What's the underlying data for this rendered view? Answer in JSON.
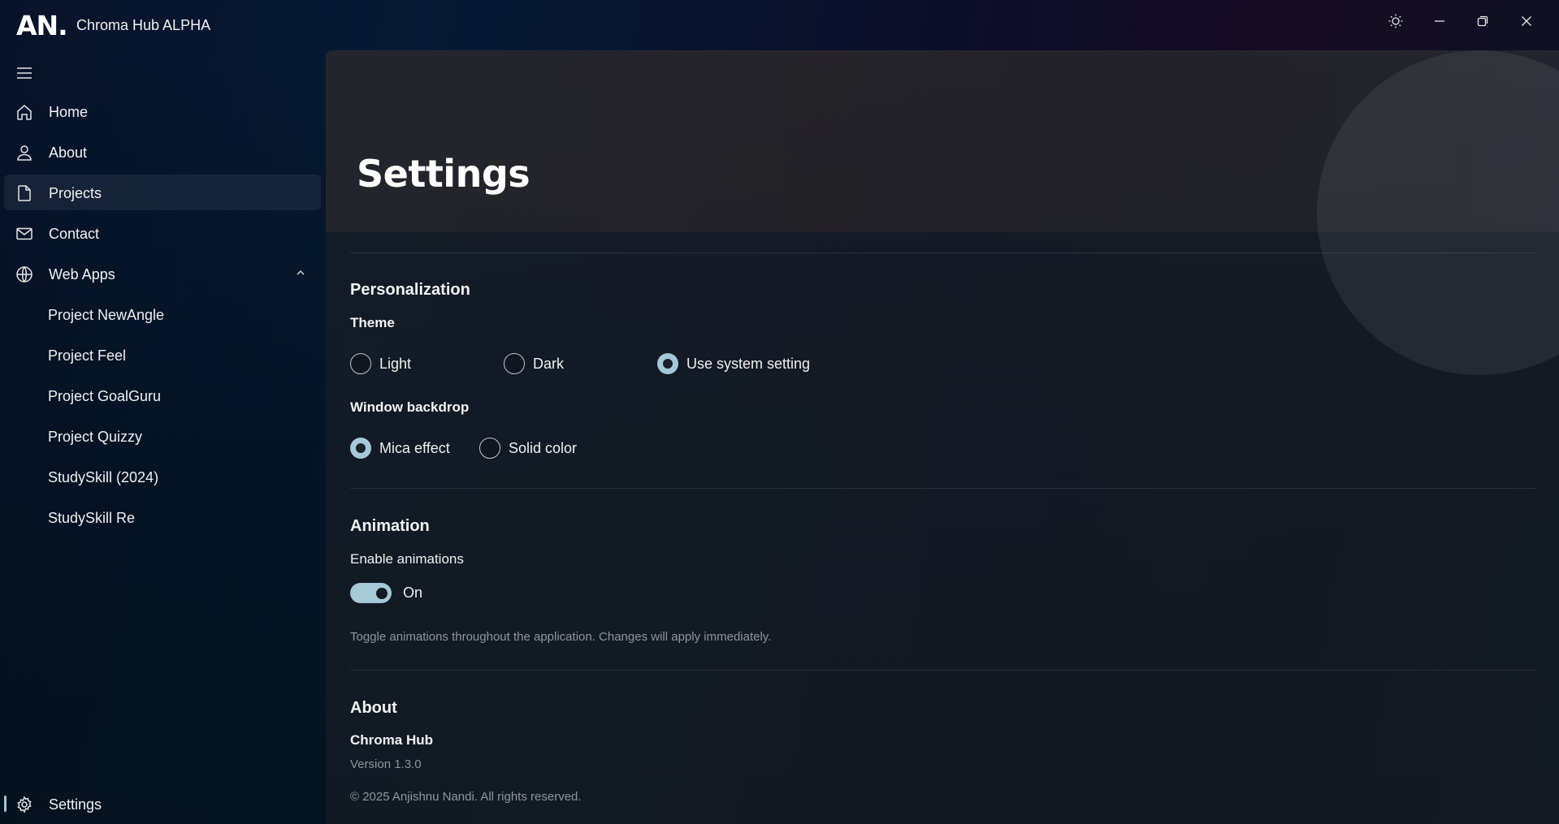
{
  "titlebar": {
    "logo": "AN.",
    "title": "Chroma Hub ALPHA",
    "buttons": [
      "theme-toggle",
      "minimize",
      "restore",
      "close"
    ]
  },
  "sidebar": {
    "items": [
      {
        "label": "Home",
        "icon": "home-icon"
      },
      {
        "label": "About",
        "icon": "person-icon"
      },
      {
        "label": "Projects",
        "icon": "document-icon",
        "active": true
      },
      {
        "label": "Contact",
        "icon": "mail-icon"
      },
      {
        "label": "Web Apps",
        "icon": "globe-icon",
        "expanded": true
      }
    ],
    "sub_items": [
      {
        "label": "Project NewAngle"
      },
      {
        "label": "Project Feel"
      },
      {
        "label": "Project GoalGuru"
      },
      {
        "label": "Project Quizzy"
      },
      {
        "label": "StudySkill (2024)"
      },
      {
        "label": "StudySkill Re"
      }
    ],
    "settings": {
      "label": "Settings",
      "icon": "gear-icon",
      "selected": true
    }
  },
  "main": {
    "title": "Settings",
    "personalization": {
      "heading": "Personalization",
      "theme_label": "Theme",
      "theme_options": [
        {
          "label": "Light",
          "checked": false
        },
        {
          "label": "Dark",
          "checked": false
        },
        {
          "label": "Use system setting",
          "checked": true
        }
      ],
      "backdrop_label": "Window backdrop",
      "backdrop_options": [
        {
          "label": "Mica effect",
          "checked": true
        },
        {
          "label": "Solid color",
          "checked": false
        }
      ]
    },
    "animation": {
      "heading": "Animation",
      "label": "Enable animations",
      "state": "On",
      "enabled": true,
      "description": "Toggle animations throughout the application. Changes will apply immediately."
    },
    "about": {
      "heading": "About",
      "app_name": "Chroma Hub",
      "version": "Version 1.3.0",
      "copyright": "© 2025 Anjishnu Nandi. All rights reserved."
    }
  },
  "colors": {
    "accent": "#a6c8d8",
    "text": "#ffffff",
    "muted": "#8e959c"
  }
}
